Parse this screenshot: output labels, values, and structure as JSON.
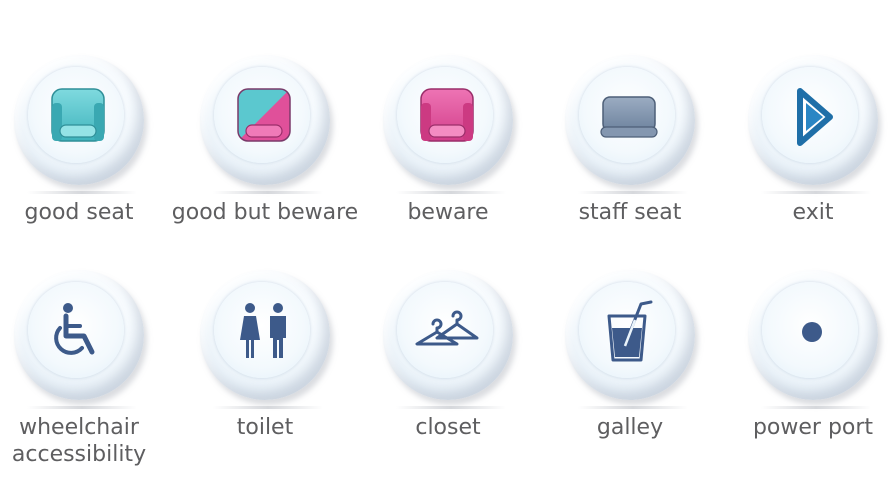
{
  "icons_row1": [
    {
      "label": "good seat",
      "icon": "teal-seat-icon",
      "color": "#5bc8cf"
    },
    {
      "label": "good but beware",
      "icon": "split-seat-icon",
      "color": "#e0509a"
    },
    {
      "label": "beware",
      "icon": "pink-seat-icon",
      "color": "#e0509a"
    },
    {
      "label": "staff seat",
      "icon": "staff-seat-icon",
      "color": "#7d90a8"
    },
    {
      "label": "exit",
      "icon": "exit-arrow-icon",
      "color": "#1f6fa8"
    }
  ],
  "icons_row2": [
    {
      "label_line1": "wheelchair",
      "label_line2": "accessibility",
      "icon": "wheelchair-icon",
      "color": "#3d5a8a"
    },
    {
      "label": "toilet",
      "icon": "toilet-icon",
      "color": "#3d5a8a"
    },
    {
      "label": "closet",
      "icon": "hanger-icon",
      "color": "#3d5a8a"
    },
    {
      "label": "galley",
      "icon": "cup-icon",
      "color": "#3d5a8a"
    },
    {
      "label": "power port",
      "icon": "power-dot-icon",
      "color": "#3d5a8a"
    }
  ]
}
